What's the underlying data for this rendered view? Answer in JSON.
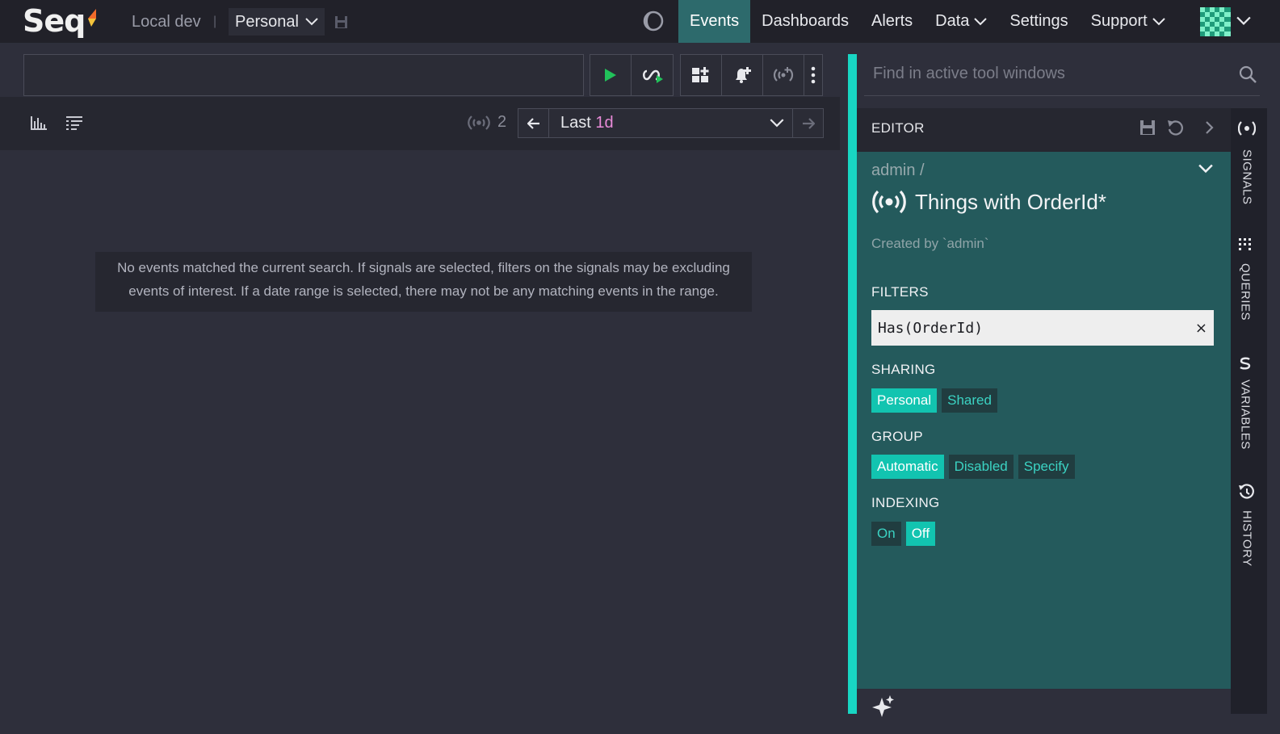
{
  "header": {
    "logo_text": "Seq",
    "instance": "Local dev",
    "separator": "|",
    "workspace": "Personal",
    "nav": [
      {
        "label": "Events",
        "active": true
      },
      {
        "label": "Dashboards",
        "active": false
      },
      {
        "label": "Alerts",
        "active": false
      },
      {
        "label": "Data",
        "active": false,
        "dropdown": true
      },
      {
        "label": "Settings",
        "active": false
      },
      {
        "label": "Support",
        "active": false,
        "dropdown": true
      }
    ]
  },
  "search": {
    "placeholder": "",
    "value": ""
  },
  "toolbar": {
    "run_icon": "play-icon",
    "tail_icon": "live-tail-icon",
    "add_to_dashboard_icon": "add-to-dashboard-icon",
    "add_alert_icon": "add-alert-icon",
    "add_signal_icon": "add-signal-icon",
    "more_icon": "more-vertical-icon"
  },
  "results_bar": {
    "signal_count": "2",
    "range_prefix": "Last",
    "range_value": "1d"
  },
  "empty_message": "No events matched the current search. If signals are selected, filters on the signals may be excluding events of interest. If a date range is selected, there may not be any matching events in the range.",
  "panel": {
    "find_placeholder": "Find in active tool windows",
    "editor_title": "EDITOR",
    "breadcrumb": "admin /",
    "signal_title": "Things with OrderId*",
    "created_by": "Created by `admin`",
    "filters_label": "FILTERS",
    "filter_value": "Has(OrderId)",
    "filter_clear": "×",
    "sharing_label": "SHARING",
    "sharing_options": [
      "Personal",
      "Shared"
    ],
    "sharing_selected": "Personal",
    "group_label": "GROUP",
    "group_options": [
      "Automatic",
      "Disabled",
      "Specify"
    ],
    "group_selected": "Automatic",
    "indexing_label": "INDEXING",
    "indexing_options": [
      "On",
      "Off"
    ],
    "indexing_selected": "Off"
  },
  "side_tabs": [
    "SIGNALS",
    "QUERIES",
    "VARIABLES",
    "HISTORY"
  ],
  "colors": {
    "accent": "#18d6c3",
    "selected_option": "#12c4b0",
    "editor_bg": "#245a5c",
    "active_nav": "#2d6a6c",
    "time_highlight": "#e98bd9"
  }
}
